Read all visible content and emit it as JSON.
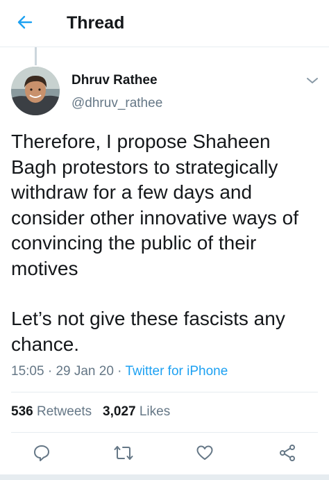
{
  "header": {
    "title": "Thread",
    "back_icon": "back-arrow-icon"
  },
  "tweet": {
    "author": {
      "name": "Dhruv Rathee",
      "handle": "@dhruv_rathee",
      "avatar_icon": "avatar"
    },
    "text": {
      "paragraph1": "Therefore, I propose Shaheen Bagh protestors to strategically withdraw for a few days and consider other innovative ways of convincing the public of their motives",
      "paragraph2": "Let’s not give these fascists any chance."
    },
    "meta": {
      "time": "15:05",
      "separator": " · ",
      "date": "29 Jan 20",
      "source": "Twitter for iPhone"
    },
    "stats": {
      "retweets_count": "536",
      "retweets_label": "Retweets",
      "likes_count": "3,027",
      "likes_label": "Likes"
    },
    "actions": [
      "reply-icon",
      "retweet-icon",
      "like-icon",
      "share-icon"
    ]
  },
  "colors": {
    "accent": "#1da1f2",
    "text_primary": "#14171a",
    "text_secondary": "#657786",
    "divider": "#e6ecf0"
  }
}
